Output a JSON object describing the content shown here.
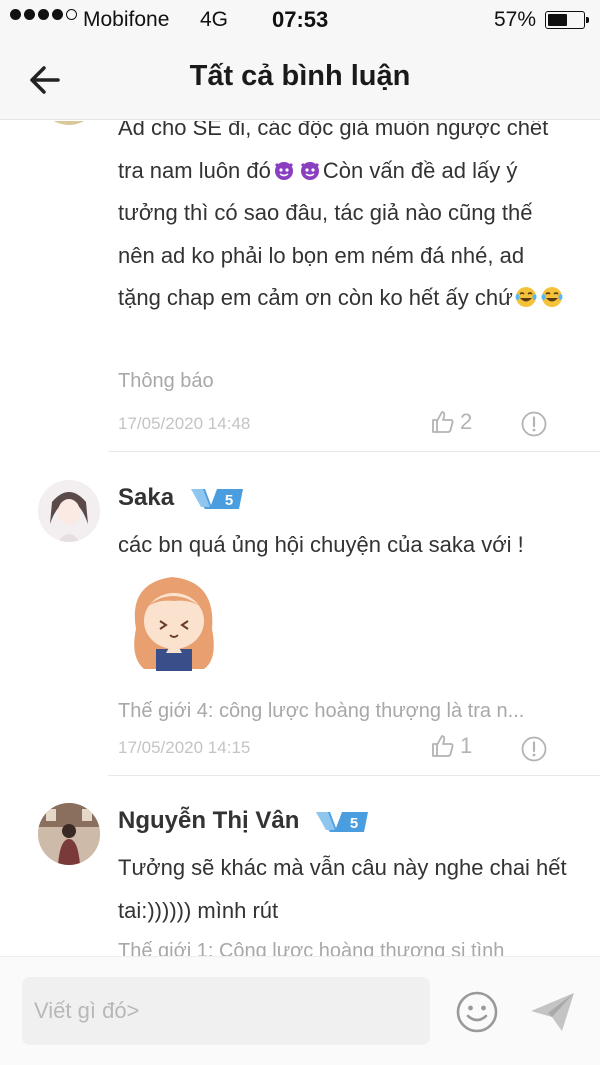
{
  "status_bar": {
    "carrier": "Mobifone",
    "network": "4G",
    "time": "07:53",
    "battery": "57%",
    "battery_level": 0.57
  },
  "nav": {
    "title": "Tất cả bình luận"
  },
  "comments": [
    {
      "text_part1": "Ad cho SE đi, các độc giả muốn ngược chết tra nam luôn đó",
      "text_part2": "Còn vấn đề ad lấy ý tưởng thì có sao đâu, tác giả nào cũng thế nên ad ko phải lo bọn em ném đá nhé, ad tặng chap em cảm ơn còn ko hết ấy chứ",
      "emoji_1": "devil-emoji",
      "emoji_2": "laughing-tears-emoji",
      "source": "Thông báo",
      "timestamp": "17/05/2020 14:48",
      "likes": "2"
    },
    {
      "username": "Saka",
      "level": "5",
      "text": "các bn quá ủng hội chuyện của saka với !",
      "sticker": "anime-girl-praying-sticker",
      "source": "Thế giới 4: công lược hoàng thượng là tra n...",
      "timestamp": "17/05/2020 14:15",
      "likes": "1"
    },
    {
      "username": "Nguyễn Thị Vân",
      "level": "5",
      "text": "Tưởng sẽ khác mà vẫn câu này nghe chai hết tai:)))))) mình rút",
      "source": "Thế giới 1: Công lược hoàng thượng si tình"
    }
  ],
  "input": {
    "placeholder": "Viết gì đó>"
  },
  "colors": {
    "badge_blue": "#4a9ee0",
    "badge_light": "#8fc6f0",
    "accent_text": "#333333",
    "muted_text": "#a8a8a8"
  }
}
